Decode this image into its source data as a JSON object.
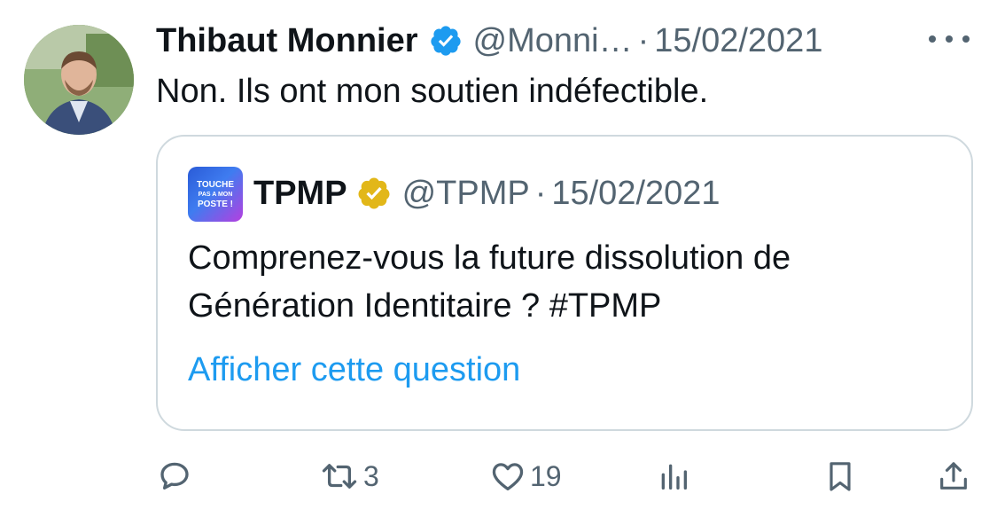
{
  "tweet": {
    "author": {
      "name": "Thibaut Monnier",
      "handle": "@Monni…",
      "verified_icon": "verified-badge-icon",
      "avatar_icon": "person-avatar"
    },
    "separator": "·",
    "date": "15/02/2021",
    "text": "Non. Ils ont mon soutien indéfectible.",
    "more_icon": "more-horizontal-icon",
    "quoted": {
      "author": {
        "name": "TPMP",
        "handle": "@TPMP",
        "badge_icon": "gold-verified-badge-icon",
        "avatar_logo": [
          "TOUCHE",
          "PAS A MON",
          "POSTE !"
        ]
      },
      "separator": "·",
      "date": "15/02/2021",
      "text_lines": [
        "Comprenez-vous la future dissolution de",
        "Génération Identitaire ? #TPMP"
      ],
      "link_label": "Afficher cette question"
    },
    "actions": {
      "reply": {
        "icon": "reply-icon",
        "count": ""
      },
      "retweet": {
        "icon": "retweet-icon",
        "count": "3"
      },
      "like": {
        "icon": "heart-icon",
        "count": "19"
      },
      "views": {
        "icon": "views-chart-icon",
        "count": ""
      },
      "bookmark": {
        "icon": "bookmark-icon",
        "count": ""
      },
      "share": {
        "icon": "share-icon",
        "count": ""
      }
    }
  },
  "colors": {
    "text_primary": "#0f1419",
    "text_secondary": "#536471",
    "link": "#1d9bf0",
    "verified_blue": "#1d9bf0",
    "verified_gold": "#e2b719",
    "border": "#cfd9de"
  }
}
